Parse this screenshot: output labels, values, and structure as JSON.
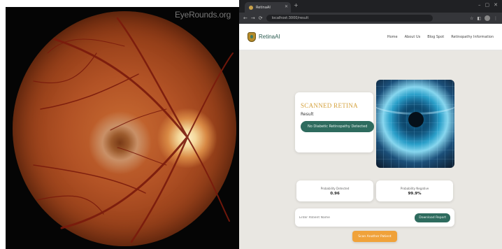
{
  "left_image": {
    "watermark": "EyeRounds.org"
  },
  "browser": {
    "tab_title": "RetinaAI",
    "url": "localhost:3000/result",
    "zoom": "",
    "colors": {
      "brand_green": "#2e6b5e",
      "accent_gold": "#d4a13c",
      "scan_orange": "#f0a23a"
    }
  },
  "site": {
    "logo_text": "RetinaAI",
    "nav": [
      "Home",
      "About Us",
      "Blog Spot",
      "Retinopathy Information"
    ],
    "scan_card": {
      "title": "SCANNED RETINA",
      "result_label": "Result",
      "result_button": "No Diabetic Retinopathy Detected"
    },
    "stats": [
      {
        "label": "Probability Detected",
        "value": "0.96"
      },
      {
        "label": "Probability Negative",
        "value": "99.9%"
      }
    ],
    "input": {
      "placeholder": "Enter Patient Name",
      "button": "Download Report"
    },
    "scan_button": "Scan Another Patient"
  }
}
